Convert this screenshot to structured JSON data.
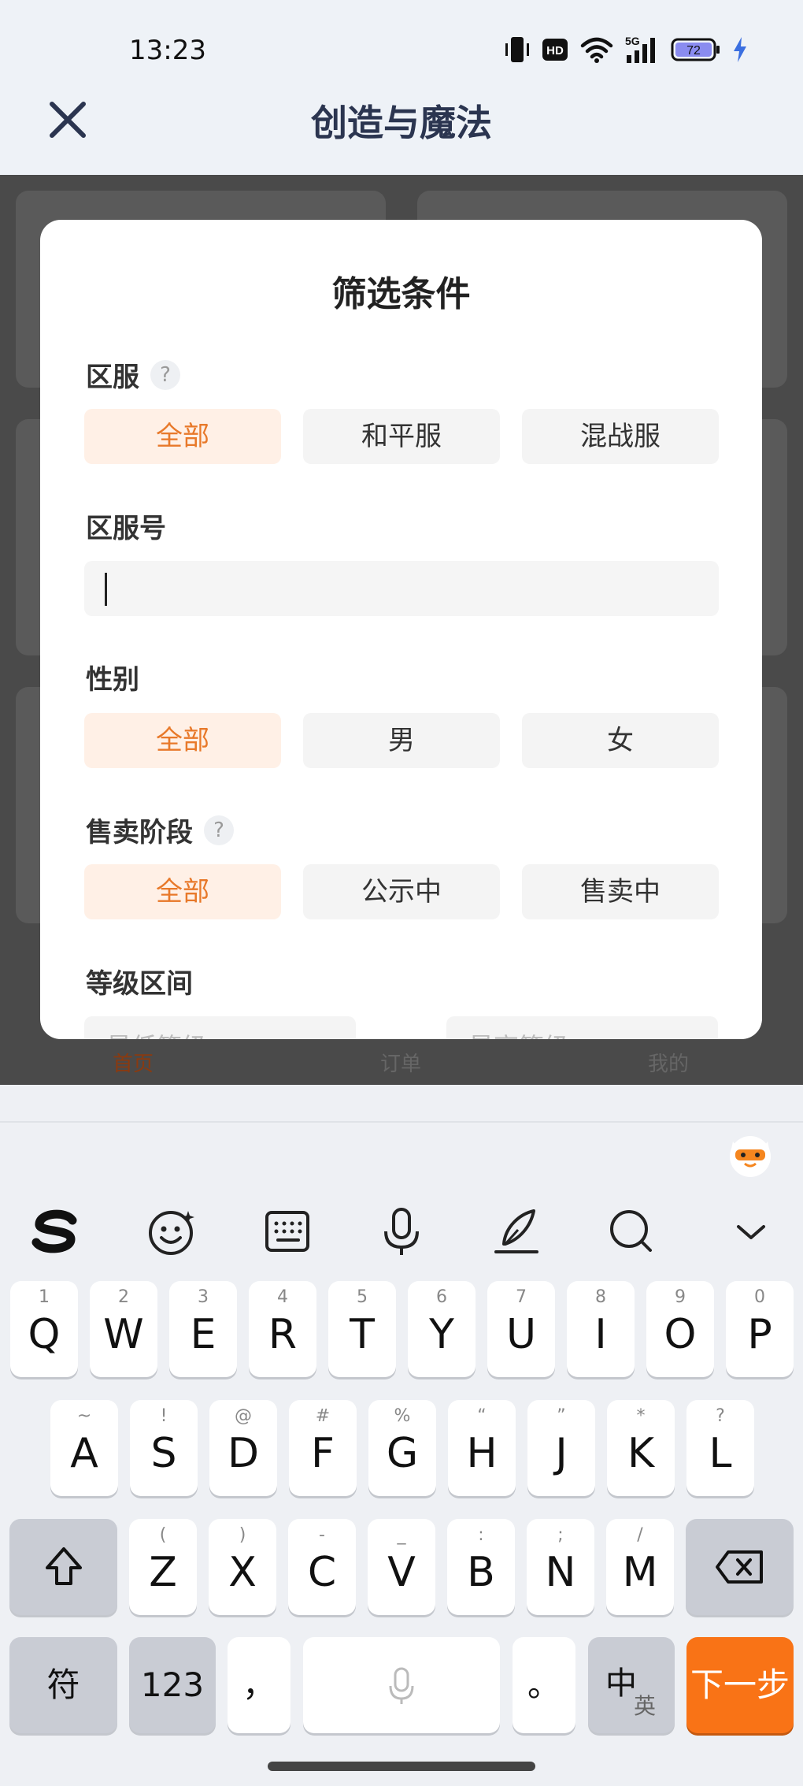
{
  "status_bar": {
    "time": "13:23",
    "battery": "72",
    "network": "5G",
    "hd": "HD"
  },
  "header": {
    "title": "创造与魔法"
  },
  "background_nav": {
    "items": [
      "首页",
      "订单",
      "我的"
    ]
  },
  "modal": {
    "title": "筛选条件",
    "server": {
      "label": "区服",
      "help": "?",
      "options": [
        "全部",
        "和平服",
        "混战服"
      ],
      "selected": "全部"
    },
    "server_number": {
      "label": "区服号",
      "value": ""
    },
    "gender": {
      "label": "性别",
      "options": [
        "全部",
        "男",
        "女"
      ],
      "selected": "全部"
    },
    "sale_stage": {
      "label": "售卖阶段",
      "help": "?",
      "options": [
        "全部",
        "公示中",
        "售卖中"
      ],
      "selected": "全部"
    },
    "level_range": {
      "label": "等级区间",
      "min_placeholder": "最低等级",
      "max_placeholder": "最高等级"
    }
  },
  "keyboard": {
    "row1": [
      {
        "k": "Q",
        "s": "1"
      },
      {
        "k": "W",
        "s": "2"
      },
      {
        "k": "E",
        "s": "3"
      },
      {
        "k": "R",
        "s": "4"
      },
      {
        "k": "T",
        "s": "5"
      },
      {
        "k": "Y",
        "s": "6"
      },
      {
        "k": "U",
        "s": "7"
      },
      {
        "k": "I",
        "s": "8"
      },
      {
        "k": "O",
        "s": "9"
      },
      {
        "k": "P",
        "s": "0"
      }
    ],
    "row2": [
      {
        "k": "A",
        "s": "~"
      },
      {
        "k": "S",
        "s": "!"
      },
      {
        "k": "D",
        "s": "@"
      },
      {
        "k": "F",
        "s": "#"
      },
      {
        "k": "G",
        "s": "%"
      },
      {
        "k": "H",
        "s": "“"
      },
      {
        "k": "J",
        "s": "”"
      },
      {
        "k": "K",
        "s": "*"
      },
      {
        "k": "L",
        "s": "?"
      }
    ],
    "row3": [
      {
        "k": "Z",
        "s": "("
      },
      {
        "k": "X",
        "s": ")"
      },
      {
        "k": "C",
        "s": "-"
      },
      {
        "k": "V",
        "s": "_"
      },
      {
        "k": "B",
        "s": ":"
      },
      {
        "k": "N",
        "s": ";"
      },
      {
        "k": "M",
        "s": "/"
      }
    ],
    "symbols_label": "符",
    "numbers_label": "123",
    "comma_label": "，",
    "period_label": "。",
    "lang_main": "中",
    "lang_sub": "英",
    "enter_label": "下一步",
    "accent_color": "#f97316"
  }
}
